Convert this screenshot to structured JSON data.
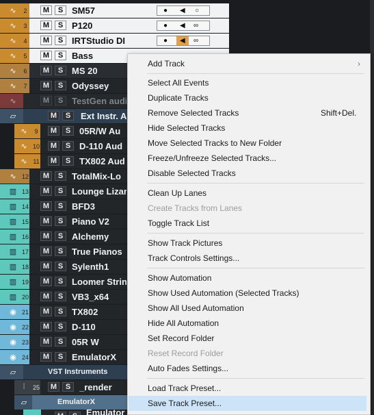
{
  "tracks": [
    {
      "num": "2",
      "name": "SM57",
      "kind": "audio"
    },
    {
      "num": "3",
      "name": "P120",
      "kind": "audio"
    },
    {
      "num": "4",
      "name": "IRTStudio DI",
      "kind": "audio"
    },
    {
      "num": "5",
      "name": "Bass",
      "kind": "audio"
    },
    {
      "num": "6",
      "name": "MS 20",
      "kind": "audio"
    },
    {
      "num": "7",
      "name": "Odyssey",
      "kind": "audio"
    },
    {
      "num": "",
      "name": "TestGen audi",
      "kind": "audio"
    },
    {
      "num": "",
      "name": "Ext Instr. A",
      "kind": "folder"
    },
    {
      "num": "9",
      "name": "05R/W Au",
      "kind": "audio"
    },
    {
      "num": "10",
      "name": "D-110 Aud",
      "kind": "audio"
    },
    {
      "num": "11",
      "name": "TX802 Aud",
      "kind": "audio"
    },
    {
      "num": "12",
      "name": "TotalMix-Lo",
      "kind": "audio"
    },
    {
      "num": "13",
      "name": "Lounge Lizar",
      "kind": "instrument"
    },
    {
      "num": "14",
      "name": "BFD3",
      "kind": "instrument"
    },
    {
      "num": "15",
      "name": "Piano V2",
      "kind": "instrument"
    },
    {
      "num": "16",
      "name": "Alchemy",
      "kind": "instrument"
    },
    {
      "num": "17",
      "name": "True Pianos",
      "kind": "instrument"
    },
    {
      "num": "18",
      "name": "Sylenth1",
      "kind": "instrument"
    },
    {
      "num": "19",
      "name": "Loomer Strin",
      "kind": "instrument"
    },
    {
      "num": "20",
      "name": "VB3_x64",
      "kind": "instrument"
    },
    {
      "num": "21",
      "name": "TX802",
      "kind": "midi"
    },
    {
      "num": "22",
      "name": "D-110",
      "kind": "midi"
    },
    {
      "num": "23",
      "name": "05R W",
      "kind": "midi"
    },
    {
      "num": "24",
      "name": "EmulatorX",
      "kind": "midi"
    },
    {
      "num": "",
      "name": "VST Instruments",
      "kind": "folder"
    },
    {
      "num": "25",
      "name": "_render",
      "kind": "fx"
    },
    {
      "num": "",
      "name": "EmulatorX",
      "kind": "folder"
    },
    {
      "num": "",
      "name": "Emulator",
      "kind": "audio"
    }
  ],
  "ms_labels": {
    "mute": "M",
    "solo": "S"
  },
  "menu": {
    "add_track": "Add Track",
    "select_all_events": "Select All Events",
    "duplicate_tracks": "Duplicate Tracks",
    "remove_selected_tracks": "Remove Selected Tracks",
    "remove_shortcut": "Shift+Del.",
    "hide_selected_tracks": "Hide Selected Tracks",
    "move_to_folder": "Move Selected Tracks to New Folder",
    "freeze_unfreeze": "Freeze/Unfreeze Selected Tracks...",
    "disable_selected": "Disable Selected Tracks",
    "clean_up_lanes": "Clean Up Lanes",
    "create_from_lanes": "Create Tracks from Lanes",
    "toggle_track_list": "Toggle Track List",
    "show_track_pictures": "Show Track Pictures",
    "track_controls_settings": "Track Controls Settings...",
    "show_automation": "Show Automation",
    "show_used_automation_selected": "Show Used Automation (Selected Tracks)",
    "show_all_used_automation": "Show All Used Automation",
    "hide_all_automation": "Hide All Automation",
    "set_record_folder": "Set Record Folder",
    "reset_record_folder": "Reset Record Folder",
    "auto_fades_settings": "Auto Fades Settings...",
    "load_track_preset": "Load Track Preset...",
    "save_track_preset": "Save Track Preset..."
  },
  "colors": {
    "audio": "#c98b2e",
    "instrument": "#5ec8bd",
    "midi": "#6fb8d9",
    "menu_highlight": "#cde3f7"
  }
}
